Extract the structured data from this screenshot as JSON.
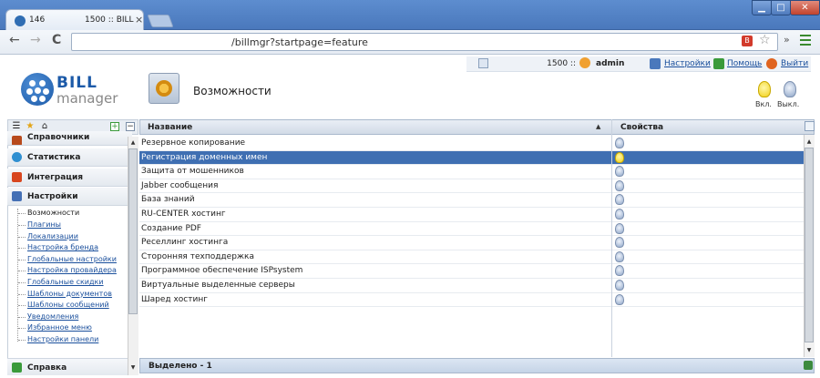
{
  "browser": {
    "tab_count": "146",
    "tab_title": "1500 :: BILL",
    "tab_close": "×",
    "address": "/billmgr?startpage=feature",
    "win_min": "▁",
    "win_max": "□",
    "win_close": "✕",
    "nav_back": "←",
    "nav_forward": "→",
    "nav_reload": "C",
    "ext_label": "B",
    "star": "☆",
    "more": "»"
  },
  "topbar": {
    "balance": "1500 ::",
    "username": "admin",
    "settings": "Настройки",
    "help": "Помощь",
    "logout": "Выйти"
  },
  "logo": {
    "line1": "BILL",
    "line2": "manager"
  },
  "page": {
    "title": "Возможности",
    "on_label": "Вкл.",
    "off_label": "Выкл."
  },
  "sidebar": {
    "plus": "+",
    "minus": "−",
    "tab_icons": [
      "☰",
      "★",
      "⌂"
    ],
    "sections": [
      {
        "label": "Справочники",
        "color": "#b84a1c"
      },
      {
        "label": "Статистика",
        "color": "#2f8fd1"
      },
      {
        "label": "Интеграция",
        "color": "#d8461f"
      },
      {
        "label": "Настройки",
        "color": "#4470b5"
      }
    ],
    "current_item": "Возможности",
    "items": [
      "Плагины",
      "Локализации",
      "Настройка бренда",
      "Глобальные настройки",
      "Настройка провайдера",
      "Глобальные скидки",
      "Шаблоны документов",
      "Шаблоны сообщений",
      "Уведомления",
      "Избранное меню",
      "Настройки панели"
    ],
    "help": "Справка"
  },
  "table": {
    "col_name": "Название",
    "col_props": "Свойства",
    "sort_arrow": "▲",
    "rows": [
      {
        "name": "Резервное копирование",
        "enabled": false
      },
      {
        "name": "Регистрация доменных имен",
        "enabled": true
      },
      {
        "name": "Защита от мошенников",
        "enabled": false
      },
      {
        "name": "Jabber сообщения",
        "enabled": false
      },
      {
        "name": "База знаний",
        "enabled": false
      },
      {
        "name": "RU-CENTER хостинг",
        "enabled": false
      },
      {
        "name": "Создание PDF",
        "enabled": false
      },
      {
        "name": "Реселлинг хостинга",
        "enabled": false
      },
      {
        "name": "Сторонняя техподдержка",
        "enabled": false
      },
      {
        "name": "Программное обеспечение ISPsystem",
        "enabled": false
      },
      {
        "name": "Виртуальные выделенные серверы",
        "enabled": false
      },
      {
        "name": "Шаред хостинг",
        "enabled": false
      }
    ],
    "footer": "Выделено - 1",
    "scroll_up": "▲",
    "scroll_down": "▼"
  }
}
